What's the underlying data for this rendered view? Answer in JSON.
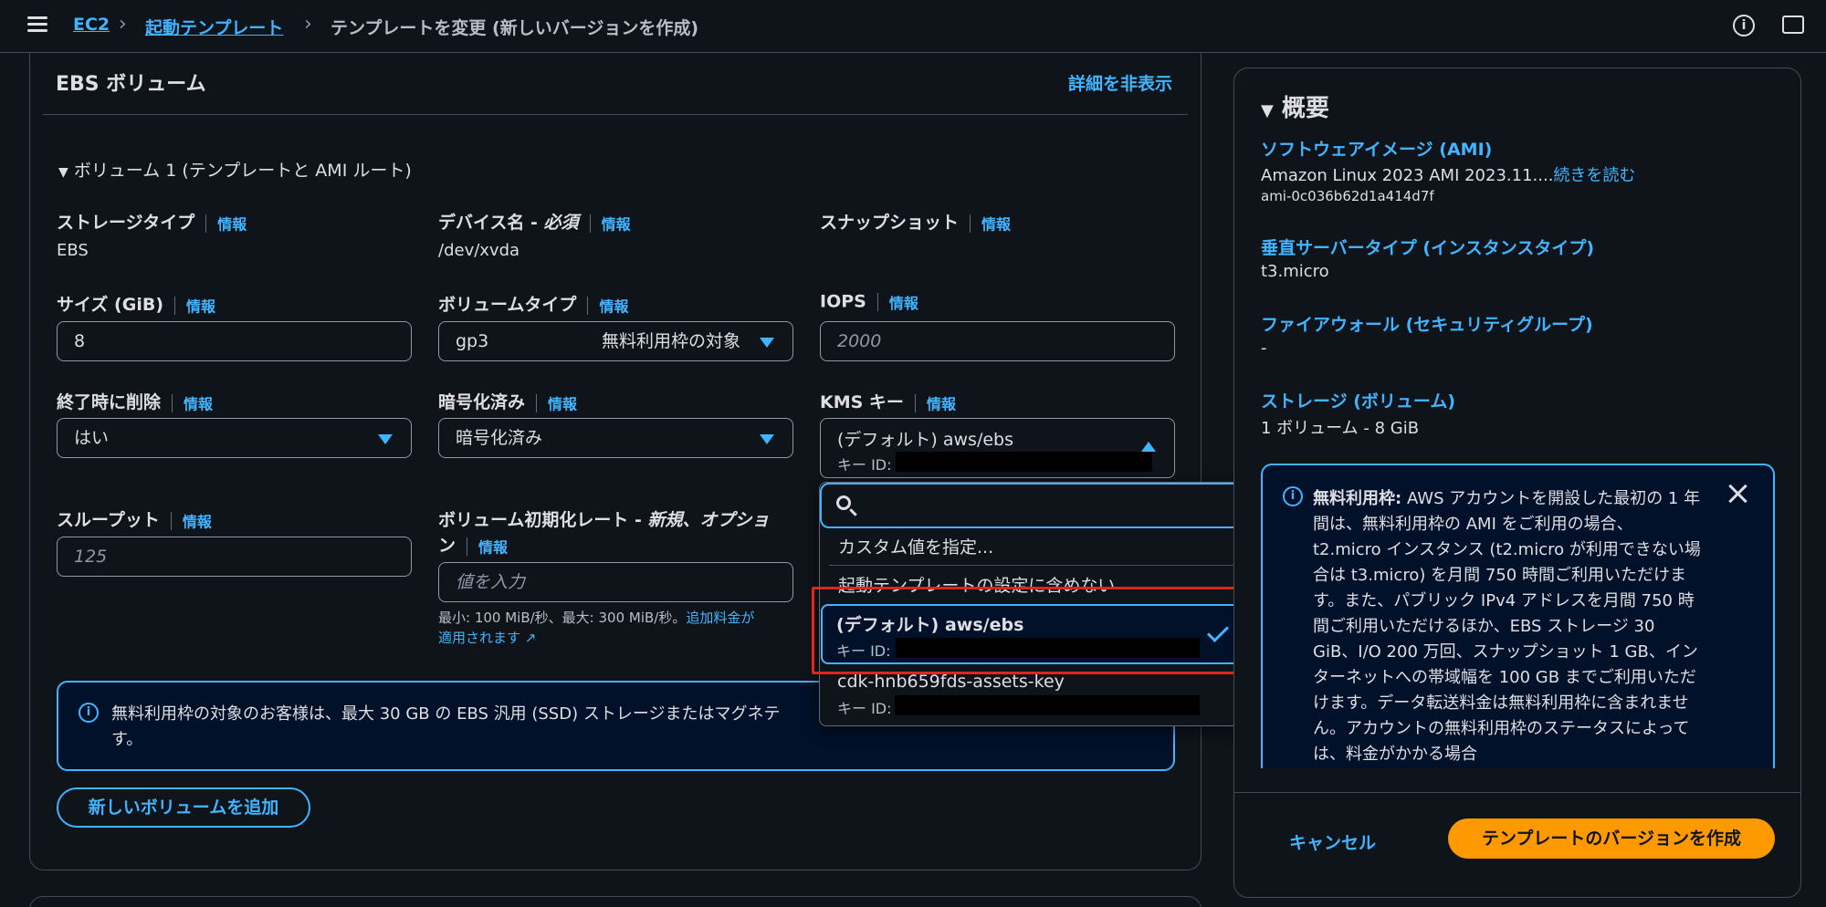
{
  "breadcrumb": {
    "ec2": "EC2",
    "launch_templates": "起動テンプレート",
    "current": "テンプレートを変更 (新しいバージョンを作成)"
  },
  "ebs": {
    "title": "EBS ボリューム",
    "toggle_details": "詳細を非表示",
    "volume_header": "ボリューム 1 (テンプレートと AMI ルート)",
    "info": "情報",
    "storage_type": {
      "label": "ストレージタイプ",
      "value": "EBS"
    },
    "device_name": {
      "label": "デバイス名 - ",
      "label_em": "必須",
      "value": "/dev/xvda"
    },
    "snapshot": {
      "label": "スナップショット"
    },
    "size": {
      "label": "サイズ (GiB)",
      "value": "8"
    },
    "volume_type": {
      "label": "ボリュームタイプ",
      "value": "gp3",
      "badge": "無料利用枠の対象"
    },
    "iops": {
      "label": "IOPS",
      "placeholder": "2000"
    },
    "delete_on_termination": {
      "label": "終了時に削除",
      "value": "はい"
    },
    "encrypted": {
      "label": "暗号化済み",
      "value": "暗号化済み"
    },
    "kms_key": {
      "label": "KMS キー",
      "value": "(デフォルト) aws/ebs",
      "key_id_label": "キー ID:"
    },
    "throughput": {
      "label": "スループット",
      "placeholder": "125"
    },
    "init_rate": {
      "label_line1": "ボリューム初期化レート - ",
      "label_line1_em": "新規、オプショ",
      "label_line2": "ン",
      "placeholder": "値を入力",
      "hint_line1": "最小: 100 MiB/秒、最大: 300 MiB/秒。",
      "hint_link1": "追加料金が",
      "hint_link2": "適用されます"
    },
    "free_tier_alert_line1": "無料利用枠の対象のお客様は、最大 30 GB の EBS 汎用 (SSD) ストレージまたはマグネテ",
    "free_tier_alert_line2": "す。",
    "add_volume": "新しいボリュームを追加"
  },
  "kms_dropdown": {
    "search_placeholder": "",
    "custom_value": "カスタム値を指定...",
    "exclude": "起動テンプレートの設定に含めない",
    "options": [
      {
        "name": "(デフォルト) aws/ebs",
        "key_id_label": "キー ID:",
        "selected": true
      },
      {
        "name": "cdk-hnb659fds-assets-key",
        "key_id_label": "キー ID:",
        "selected": false
      }
    ]
  },
  "summary": {
    "title": "概要",
    "ami_label": "ソフトウェアイメージ (AMI)",
    "ami_value": "Amazon Linux 2023 AMI 2023.11....",
    "ami_read_more": "続きを読む",
    "ami_id": "ami-0c036b62d1a414d7f",
    "instance_type_label": "垂直サーバータイプ (インスタンスタイプ)",
    "instance_type_value": "t3.micro",
    "firewall_label": "ファイアウォール (セキュリティグループ)",
    "firewall_value": "-",
    "storage_label": "ストレージ (ボリューム)",
    "storage_value": "1 ボリューム - 8 GiB",
    "free_tier_title": "無料利用枠:",
    "free_tier_text": "AWS アカウントを開設した最初の 1 年間は、無料利用枠の AMI をご利用の場合、t2.micro インスタンス (t2.micro が利用できない場合は t3.micro) を月間 750 時間ご利用いただけます。また、パブリック IPv4 アドレスを月間 750 時間ご利用いただけるほか、EBS ストレージ 30 GiB、I/O 200 万回、スナップショット 1 GB、インターネットへの帯域幅を 100 GB までご利用いただけます。データ転送料金は無料利用枠に含まれません。アカウントの無料利用枠のステータスによっては、料金がかかる場合",
    "cancel": "キャンセル",
    "create_version": "テンプレートのバージョンを作成"
  },
  "colors": {
    "accent": "#42b4ff",
    "primary_button": "#ff9900",
    "highlight": "#e0261b",
    "background": "#0f141a"
  }
}
